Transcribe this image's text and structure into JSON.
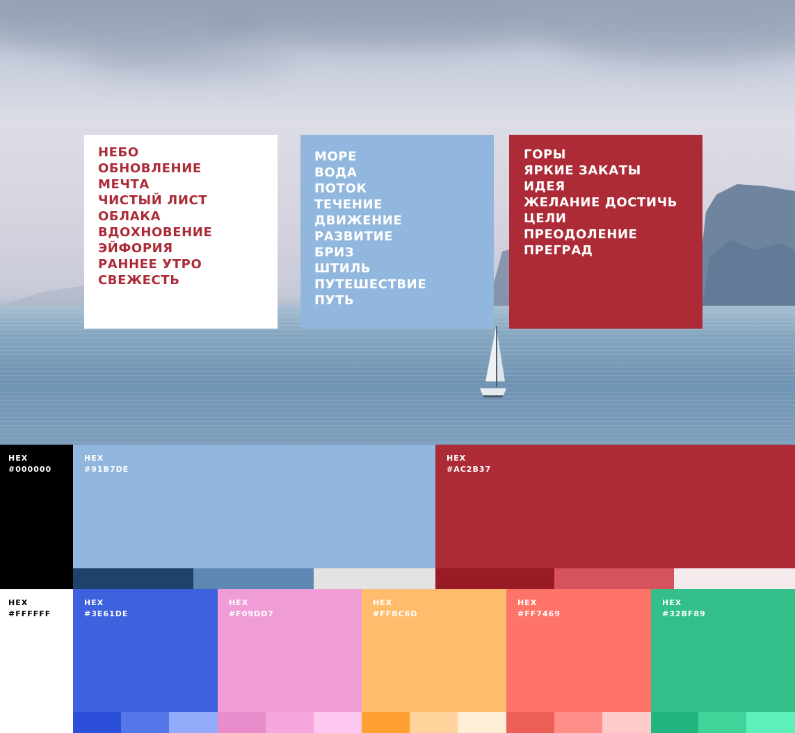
{
  "cards": {
    "sky": [
      "НЕБО",
      "ОБНОВЛЕНИЕ",
      "МЕЧТА",
      "ЧИСТЫЙ ЛИСТ",
      "ОБЛАКА",
      "ВДОХНОВЕНИЕ",
      "ЭЙФОРИЯ",
      "РАННЕЕ УТРО",
      "СВЕЖЕСТЬ"
    ],
    "sea": [
      "МОРЕ",
      "ВОДА",
      "ПОТОК",
      "ТЕЧЕНИЕ",
      "ДВИЖЕНИЕ",
      "РАЗВИТИЕ",
      "БРИЗ",
      "ШТИЛЬ",
      "ПУТЕШЕСТВИЕ",
      "ПУТЬ"
    ],
    "mountain": [
      "ГОРЫ",
      "ЯРКИЕ ЗАКАТЫ",
      "ИДЕЯ",
      "ЖЕЛАНИЕ ДОСТИЧЬ",
      "ЦЕЛИ",
      "ПРЕОДОЛЕНИЕ",
      "ПРЕГРАД"
    ]
  },
  "palette": {
    "hex_word": "HEX",
    "black": {
      "hex": "#000000",
      "color": "#000000"
    },
    "white": {
      "hex": "#FFFFFF",
      "color": "#ffffff"
    },
    "blue_light": {
      "hex": "#91B7DE",
      "color": "#91b7de",
      "tones": [
        "#1e426a",
        "#5f87b3",
        "#e3e3e3"
      ]
    },
    "red": {
      "hex": "#AC2B37",
      "color": "#ac2b37",
      "tones": [
        "#981b26",
        "#d6525d",
        "#f5ebec"
      ]
    },
    "row2": [
      {
        "hex": "#3E61DE",
        "color": "#3e61de",
        "tones": [
          "#2b4fd8",
          "#5677ea",
          "#92abf8"
        ]
      },
      {
        "hex": "#F09DD7",
        "color": "#f09dd7",
        "tones": [
          "#e98ccb",
          "#f6a6dd",
          "#fcc8ef"
        ]
      },
      {
        "hex": "#FFBC6D",
        "color": "#ffbc6d",
        "tones": [
          "#ffa033",
          "#ffd39b",
          "#ffeed6"
        ]
      },
      {
        "hex": "#FF7469",
        "color": "#ff7469",
        "tones": [
          "#ec5f55",
          "#ff8e88",
          "#ffcbc8"
        ]
      },
      {
        "hex": "#32BF89",
        "color": "#32bf89",
        "tones": [
          "#22b47e",
          "#40d39a",
          "#5ef0bb"
        ]
      }
    ]
  }
}
